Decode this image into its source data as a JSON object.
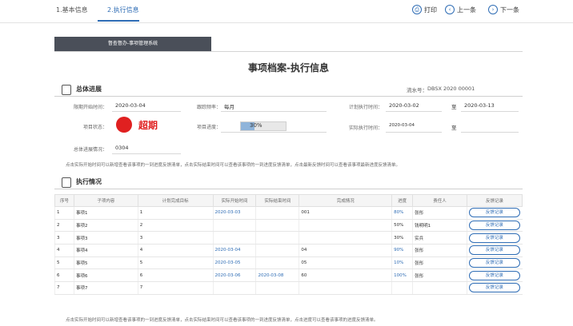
{
  "tabs": [
    {
      "label": "1.基本信息"
    },
    {
      "label": "2.执行信息"
    }
  ],
  "toolbar": {
    "print": "打印",
    "prev": "上一条",
    "next": "下一条"
  },
  "system_bar": "督查督办-事项管理系统",
  "title": "事项档案-执行信息",
  "overall": {
    "section_title": "总体进展",
    "serial_label": "流水号：",
    "serial_value": "DBSX 2020 00001",
    "fields": {
      "start_date_label": "限期开始时间：",
      "start_date_value": "2020-03-04",
      "cycle_label": "跟踪频率：",
      "cycle_value": "每月",
      "plan_time_label": "计划执行时间：",
      "plan_time_start": "2020-03-02",
      "plan_time_sep": "至",
      "plan_time_end": "2020-03-13",
      "status_label": "项目状态：",
      "status_value": "超期",
      "progress_label": "项目进度：",
      "progress_text": "30%",
      "actual_time_label": "实际执行时间：",
      "actual_time_start": "2020-03-04",
      "actual_time_sep": "至",
      "summary_label": "总体进展情况：",
      "summary_value": "0304"
    },
    "progress_fraction": 0.3,
    "status_color": "#e02020",
    "note": "点击实际开始时间可以新增查看该事项的一到进度反馈清单，点击实际结束时间可以查看该事项的一到进度反馈清单，点击最新反馈时间可以查看该事项最新进度反馈清单。"
  },
  "execution": {
    "section_title": "执行情况",
    "headers": [
      "序号",
      "子项内容",
      "计划完成目标",
      "实际开始时间",
      "实际结束时间",
      "完成情况",
      "进度",
      "责任人",
      "反馈记录"
    ],
    "rows": [
      {
        "no": "1",
        "item": "事项1",
        "target": "1",
        "start": "2020-03-03",
        "end": "",
        "detail": "001",
        "progress": "80%",
        "owner": "张彤",
        "fb": "反馈记录"
      },
      {
        "no": "2",
        "item": "事项2",
        "target": "2",
        "start": "",
        "end": "",
        "detail": "",
        "progress": "50%",
        "owner": "钱明明1",
        "fb": "反馈记录"
      },
      {
        "no": "3",
        "item": "事项3",
        "target": "3",
        "start": "",
        "end": "",
        "detail": "",
        "progress": "30%",
        "owner": "实兵",
        "fb": "反馈记录"
      },
      {
        "no": "4",
        "item": "事项4",
        "target": "4",
        "start": "2020-03-04",
        "end": "",
        "detail": "04",
        "progress": "90%",
        "owner": "张彤",
        "fb": "反馈记录"
      },
      {
        "no": "5",
        "item": "事项5",
        "target": "5",
        "start": "2020-03-05",
        "end": "",
        "detail": "05",
        "progress": "10%",
        "owner": "张彤",
        "fb": "反馈记录"
      },
      {
        "no": "6",
        "item": "事项6",
        "target": "6",
        "start": "2020-03-06",
        "end": "2020-03-08",
        "detail": "60",
        "progress": "100%",
        "owner": "张彤",
        "fb": "反馈记录"
      },
      {
        "no": "7",
        "item": "事项7",
        "target": "7",
        "start": "",
        "end": "",
        "detail": "",
        "progress": "",
        "owner": "",
        "fb": "反馈记录"
      }
    ],
    "note": "点击实际开始时间可以新增查看该事项的一到进度反馈清单，点击实际结束时间可以查看该事项的一到进度反馈清单，点击进度可以查看该事项的进度反馈清单。"
  }
}
